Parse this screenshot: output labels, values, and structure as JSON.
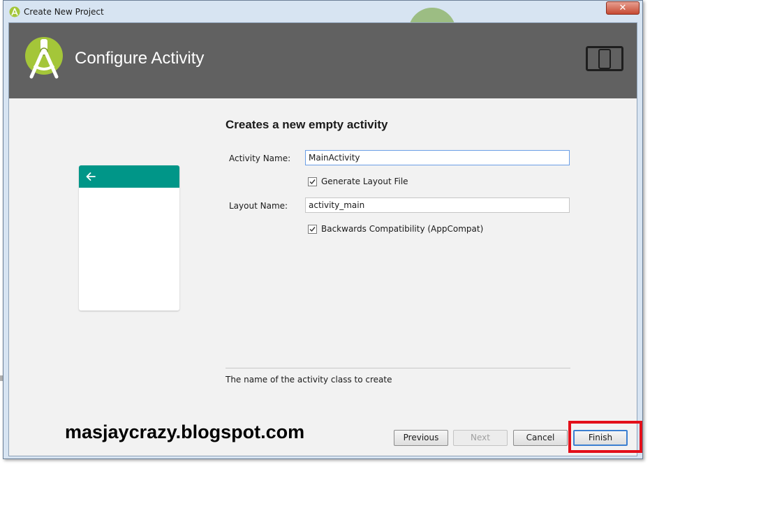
{
  "window": {
    "title": "Create New Project",
    "close_label": "✕"
  },
  "header": {
    "title": "Configure Activity"
  },
  "form": {
    "heading": "Creates a new empty activity",
    "activity_name_label": "Activity Name:",
    "activity_name_value": "MainActivity",
    "generate_layout_label": "Generate Layout File",
    "generate_layout_checked": true,
    "layout_name_label": "Layout Name:",
    "layout_name_value": "activity_main",
    "backwards_compat_label": "Backwards Compatibility (AppCompat)",
    "backwards_compat_checked": true,
    "description": "The name of the activity class to create"
  },
  "watermark": "masjaycrazy.blogspot.com",
  "buttons": {
    "previous": "Previous",
    "next": "Next",
    "cancel": "Cancel",
    "finish": "Finish"
  },
  "colors": {
    "header": "#616161",
    "preview_toolbar": "#009688",
    "highlight": "#e3101a",
    "android_green": "#a4c639"
  },
  "icons": [
    "android-studio-icon",
    "device-icon",
    "back-arrow-icon",
    "checkbox-check-icon"
  ]
}
